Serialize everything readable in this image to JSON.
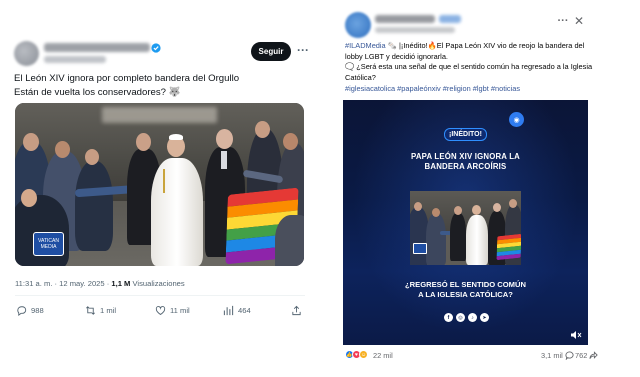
{
  "twitter": {
    "follow_label": "Seguir",
    "more_glyph": "···",
    "text_line1": "El León XIV ignora por completo bandera del Orgullo",
    "text_line2": "Están de vuelta los conservadores? 🐺",
    "time_text": "11:31 a. m. · 12 may. 2025 · ",
    "views_count": "1,1 M",
    "views_label": " Visualizaciones",
    "replies": "988",
    "reposts": "1 mil",
    "likes": "11 mil",
    "bookmarks": "464",
    "watermark_text": "VATICAN MEDIA",
    "icons": [
      "verified-badge-icon",
      "reply-icon",
      "repost-icon",
      "like-icon",
      "bookmark-icon",
      "share-icon"
    ]
  },
  "facebook": {
    "more_glyph": "···",
    "close_glyph": "✕",
    "text_line1_tag": "#ILADMedia",
    "text_line1_rest": " 🗞️ |¡Inédito!🔥El Papa León XIV vio de reojo la bandera del",
    "text_line2": "lobby LGBT y decidió ignorarla.",
    "text_line3": "🗨️ ¿Será esta una señal de que el sentido común ha regresado a la Iglesia",
    "text_line4": "Católica?",
    "hashtags": "#iglesiacatolica #papaleónxiv #religion #lgbt #noticias",
    "video": {
      "badge": "¡INÉDITO!",
      "title_line1": "PAPA LEÓN XIV IGNORA LA",
      "title_line2": "BANDERA ARCOÍRIS",
      "question_line1": "¿REGRESÓ EL SENTIDO COMÚN",
      "question_line2": "A LA IGLESIA CATÓLICA?",
      "social_icons": [
        "facebook-icon",
        "instagram-icon",
        "tiktok-icon",
        "telegram-icon"
      ]
    },
    "reactions_count": "22 mil",
    "comments_count": "3,1 mil",
    "shares_count": "762",
    "colors": {
      "link": "#385898",
      "video_bg": "#0b1a47",
      "accent": "#2f8fff"
    }
  }
}
